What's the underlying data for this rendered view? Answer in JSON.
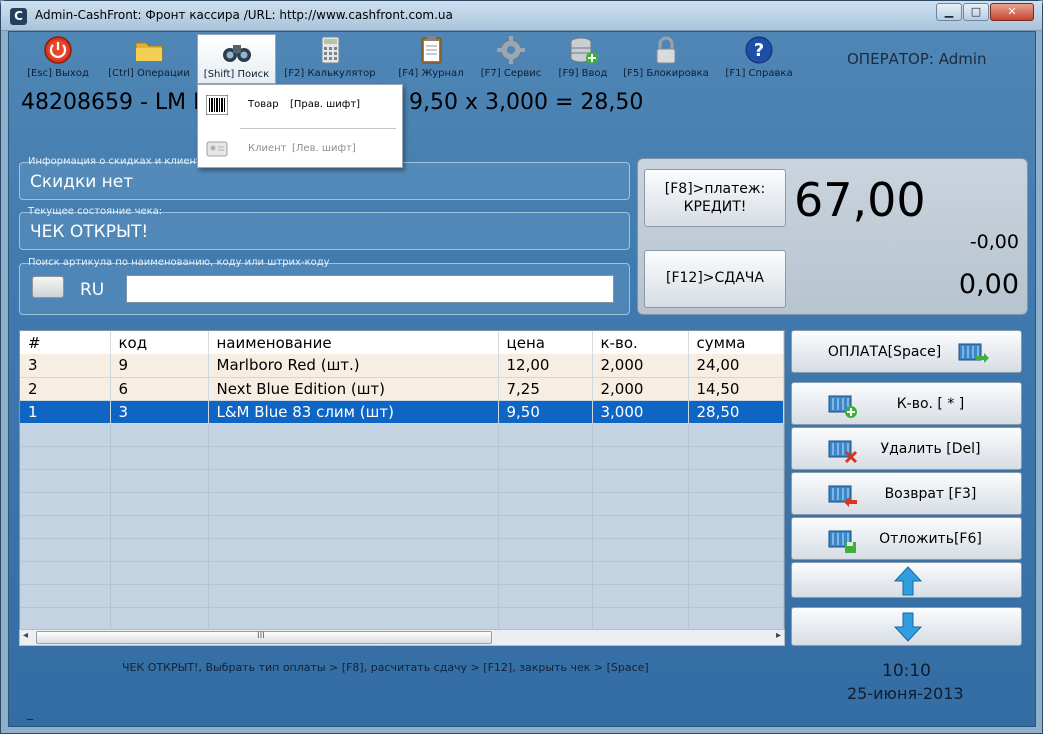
{
  "window": {
    "title": "Admin-CashFront: Фронт кассира /URL: http://www.cashfront.com.ua",
    "app_icon": "C"
  },
  "toolbar": [
    {
      "label": "[Esc] Выход",
      "icon": "power-icon"
    },
    {
      "label": "[Ctrl] Операции",
      "icon": "folder-icon"
    },
    {
      "label": "[Shift] Поиск",
      "icon": "binoculars-icon"
    },
    {
      "label": "[F2] Калькулятор",
      "icon": "calculator-icon"
    },
    {
      "label": "[F4] Журнал",
      "icon": "clipboard-icon"
    },
    {
      "label": "[F7] Сервис",
      "icon": "gear-icon"
    },
    {
      "label": "[F9] Ввод",
      "icon": "database-icon"
    },
    {
      "label": "[F5] Блокировка",
      "icon": "lock-icon"
    },
    {
      "label": "[F1] Справка",
      "icon": "help-icon"
    }
  ],
  "operator": "ОПЕРАТОР: Admin",
  "scanline": {
    "left": "48208659 - LM I",
    "right": "9,50 x 3,000 = 28,50"
  },
  "search_menu": [
    {
      "label": "Товар",
      "shortcut": "[Прав. шифт]"
    },
    {
      "label": "Клиент",
      "shortcut": "[Лев. шифт]"
    }
  ],
  "discount_group": {
    "label": "Информация о скидках и клиенте",
    "value": "Скидки нет"
  },
  "receipt_group": {
    "label": "Текущее состояние чека:",
    "value": "ЧЕК ОТКРЫТ!"
  },
  "search_group": {
    "label": "Поиск артикула по наименованию, коду или штрих-коду",
    "lang": "RU",
    "value": ""
  },
  "payment": {
    "pay_button": "[F8]>платеж:\nКРЕДИТ!",
    "change_button": "[F12]>СДАЧА",
    "total": "67,00",
    "discount": "-0,00",
    "change": "0,00"
  },
  "table": {
    "columns": [
      "#",
      "код",
      "наименование",
      "цена",
      "к-во.",
      "сумма"
    ],
    "rows": [
      [
        "3",
        "9",
        "Marlboro Red (шт.)",
        "12,00",
        "2,000",
        "24,00"
      ],
      [
        "2",
        "6",
        "Next Blue Edition (шт)",
        "7,25",
        "2,000",
        "14,50"
      ],
      [
        "1",
        "3",
        "L&M Blue 83 слим (шт)",
        "9,50",
        "3,000",
        "28,50"
      ]
    ],
    "scroll_label": "III"
  },
  "actions": [
    {
      "label": "ОПЛАТА[Space]",
      "icon": "basket-pay-icon"
    },
    {
      "label": "К-во. [ * ]",
      "icon": "basket-add-icon"
    },
    {
      "label": "Удалить [Del]",
      "icon": "basket-delete-icon"
    },
    {
      "label": "Возврат [F3]",
      "icon": "basket-return-icon"
    },
    {
      "label": "Отложить[F6]",
      "icon": "basket-save-icon"
    },
    {
      "label": "",
      "icon": "arrow-up-icon"
    },
    {
      "label": "",
      "icon": "arrow-down-icon"
    }
  ],
  "status": "ЧЕК ОТКРЫТ!, Выбрать тип оплаты > [F8], расчитать сдачу > [F12], закрыть чек > [Space]",
  "time": "10:10",
  "date": "25-июня-2013",
  "cursor": "_",
  "colors": {
    "selected_row": "#0f65c4",
    "body_bg": "#3f79ad",
    "accent_blue": "#2f83d6"
  }
}
